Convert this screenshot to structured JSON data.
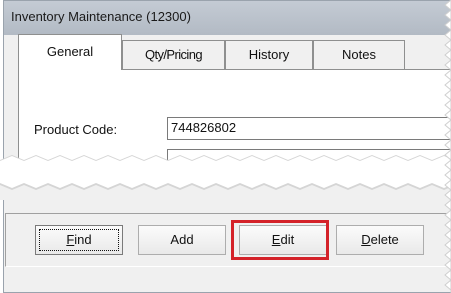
{
  "window": {
    "title": "Inventory Maintenance (12300)"
  },
  "tabs": [
    {
      "label": "General",
      "active": true
    },
    {
      "label": "Qty/Pricing",
      "active": false
    },
    {
      "label": "History",
      "active": false
    },
    {
      "label": "Notes",
      "active": false
    }
  ],
  "general": {
    "product_code_label": "Product Code:",
    "product_code_value": "744826802"
  },
  "buttons": {
    "find": {
      "mnemonic": "F",
      "rest": "ind"
    },
    "add": {
      "label": "Add"
    },
    "edit": {
      "mnemonic": "E",
      "rest": "dit"
    },
    "delete": {
      "mnemonic": "D",
      "rest": "elete"
    }
  },
  "colors": {
    "highlight": "#d42229",
    "titlebar": "#b8c0ca"
  }
}
